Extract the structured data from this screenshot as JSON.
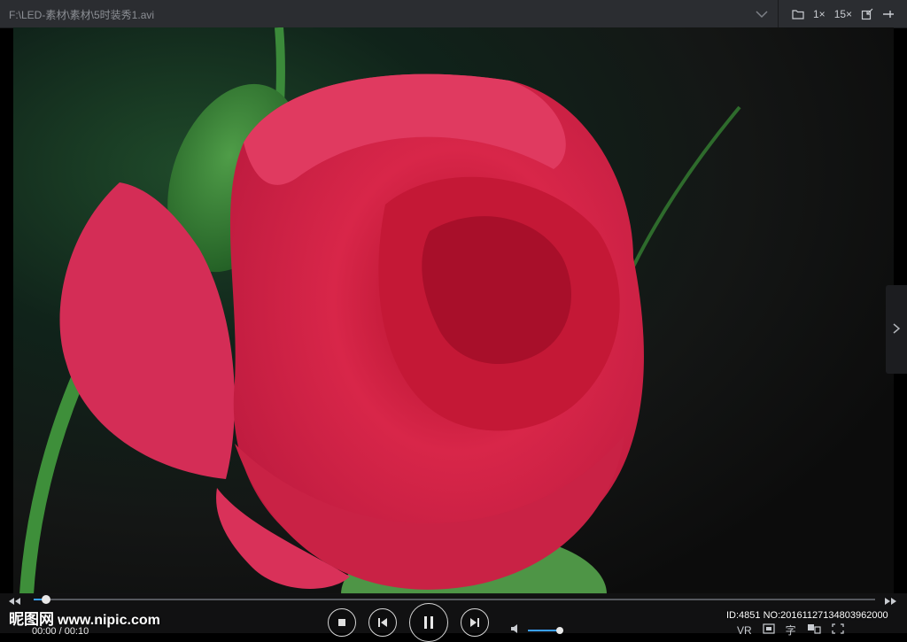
{
  "window": {
    "title": "F:\\LED-素材\\素材\\5时装秀1.avi"
  },
  "toolbar": {
    "speed_1x": "1×",
    "speed_15x": "15×"
  },
  "playback": {
    "time": "00:00 / 00:10",
    "progress": 0.015,
    "volume": 0.9
  },
  "right_tools": {
    "vr_label": "VR",
    "subtitle_label": "字"
  },
  "watermark": {
    "brand": "昵图网",
    "url": "www.nipic.com",
    "id_text": "ID:4851 NO:20161127134803962000"
  },
  "colors": {
    "accent": "#3aa0ff",
    "rose": "#d8284f"
  }
}
